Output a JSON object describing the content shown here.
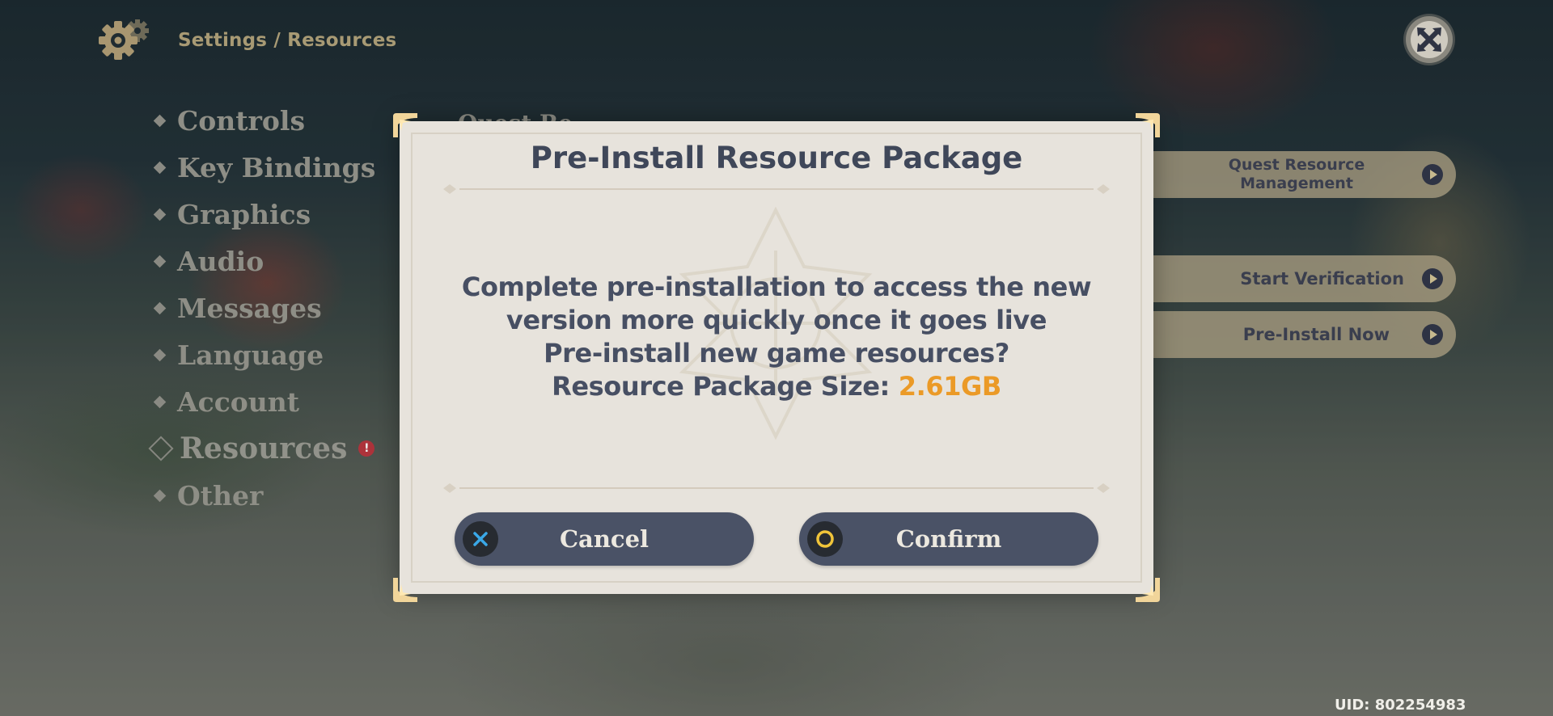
{
  "header": {
    "breadcrumb": "Settings / Resources",
    "icon": "gear-icon",
    "close_icon": "close-icon"
  },
  "sidebar": {
    "items": [
      {
        "label": "Controls",
        "active": false
      },
      {
        "label": "Key Bindings",
        "active": false
      },
      {
        "label": "Graphics",
        "active": false
      },
      {
        "label": "Audio",
        "active": false
      },
      {
        "label": "Messages",
        "active": false
      },
      {
        "label": "Language",
        "active": false
      },
      {
        "label": "Account",
        "active": false
      },
      {
        "label": "Resources",
        "active": true,
        "alert": "!"
      },
      {
        "label": "Other",
        "active": false
      }
    ]
  },
  "main": {
    "section_heading": "Quest Re",
    "actions": [
      {
        "label": "Quest Resource Management"
      },
      {
        "label": "Start Verification"
      },
      {
        "label": "Pre-Install Now"
      }
    ]
  },
  "modal": {
    "title": "Pre-Install Resource Package",
    "body_lines": [
      "Complete pre-installation to access the new",
      "version more quickly once it goes live",
      "Pre-install new game resources?"
    ],
    "size_label": "Resource Package Size: ",
    "size_value": "2.61GB",
    "cancel_label": "Cancel",
    "confirm_label": "Confirm",
    "colors": {
      "size_value": "#eb9a27",
      "cancel_badge": "#3aa8e8",
      "confirm_badge": "#f0c43a"
    }
  },
  "footer": {
    "uid": "UID: 802254983"
  }
}
